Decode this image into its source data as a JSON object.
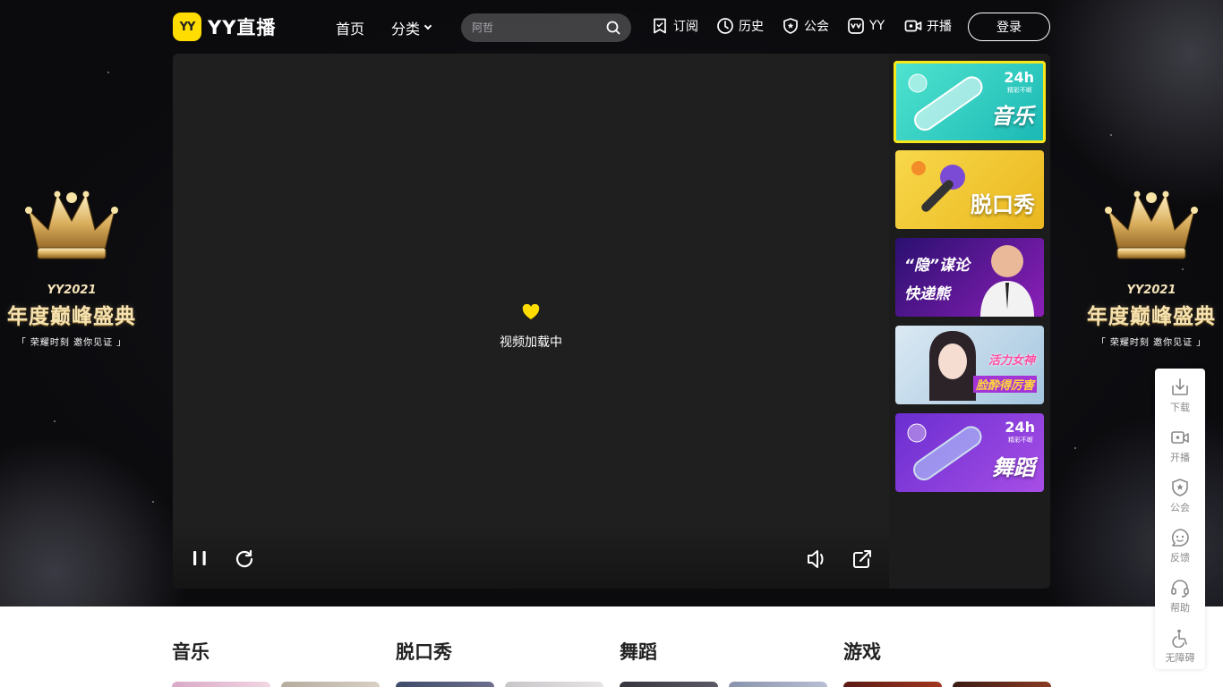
{
  "app": {
    "logo_mark": "YY",
    "logo_text": "YY直播"
  },
  "nav": {
    "home": "首页",
    "category": "分类"
  },
  "search": {
    "placeholder": "阿哲"
  },
  "header_links": [
    {
      "label": "订阅",
      "icon": "bookmark-icon"
    },
    {
      "label": "历史",
      "icon": "clock-icon"
    },
    {
      "label": "公会",
      "icon": "shield-star-icon"
    },
    {
      "label": "YY",
      "icon": "yy-app-icon"
    },
    {
      "label": "开播",
      "icon": "camera-icon"
    }
  ],
  "login": "登录",
  "side_banner": {
    "small": "YY2021",
    "big": "年度巅峰盛典",
    "tag": "「 荣耀时刻  邀你见证 」"
  },
  "player": {
    "loading_text": "视频加载中"
  },
  "channels": [
    {
      "title": "音乐",
      "badge": "24h",
      "sub": "精彩不断",
      "active": true,
      "color": "#3bd6c6"
    },
    {
      "title": "脱口秀",
      "active": false,
      "color": "#f5c838"
    },
    {
      "title_line1": "“隐”谋论",
      "title_line2": "快递熊",
      "active": false,
      "color": "#5a1fa8"
    },
    {
      "title_line1": "活力女神",
      "title_line2": "脸酔得厉害",
      "active": false,
      "color": "#a6c8e0"
    },
    {
      "title": "舞蹈",
      "badge": "24h",
      "sub": "精彩不断",
      "active": false,
      "color": "#8c3fd8"
    }
  ],
  "tools": [
    {
      "label": "下载",
      "icon": "download-icon"
    },
    {
      "label": "开播",
      "icon": "camera-icon"
    },
    {
      "label": "公会",
      "icon": "shield-star-icon"
    },
    {
      "label": "反馈",
      "icon": "feedback-icon"
    },
    {
      "label": "帮助",
      "icon": "headset-icon"
    },
    {
      "label": "无障碍",
      "icon": "accessibility-icon"
    }
  ],
  "sections": [
    "音乐",
    "脱口秀",
    "舞蹈",
    "游戏"
  ]
}
